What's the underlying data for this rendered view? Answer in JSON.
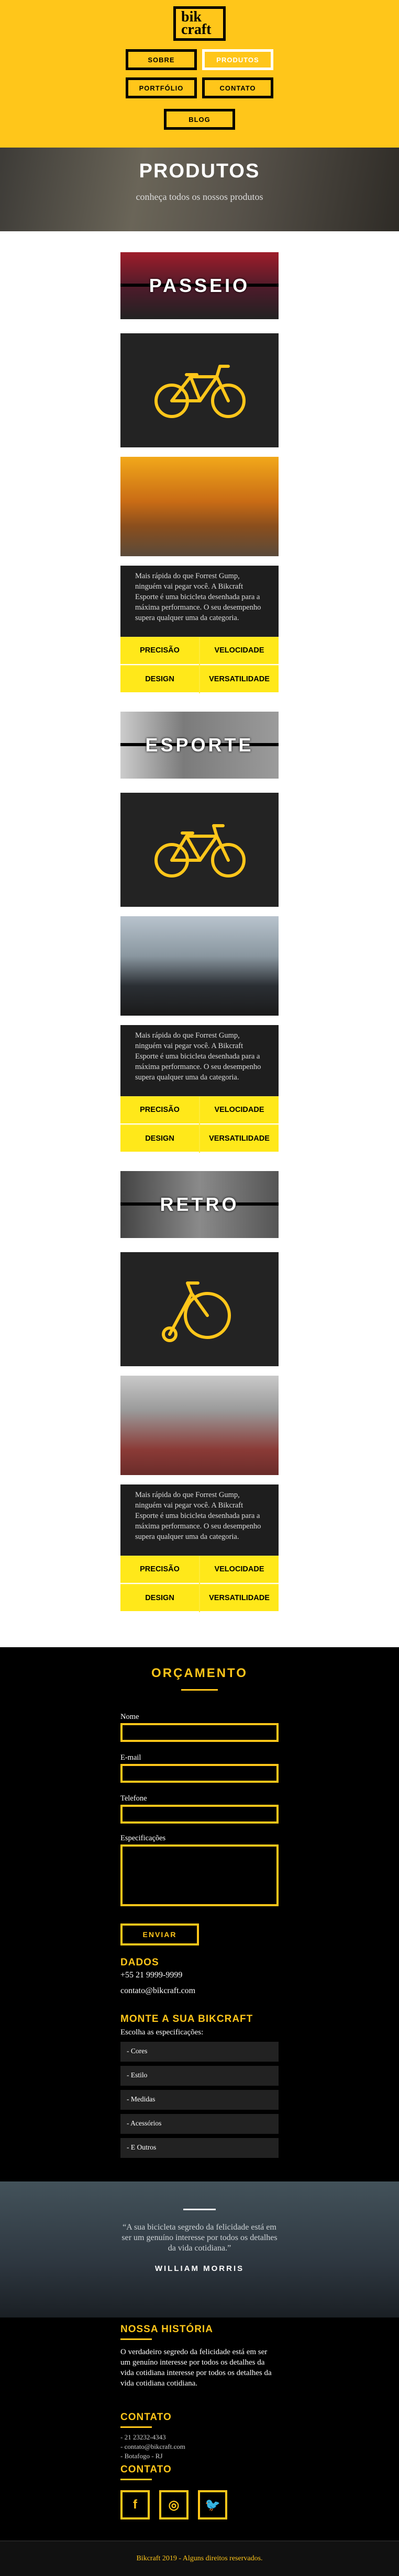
{
  "header": {
    "logo": "bikcraft",
    "nav": [
      {
        "label": "Sobre",
        "active": false
      },
      {
        "label": "Produtos",
        "active": true
      },
      {
        "label": "Portfólio",
        "active": false
      },
      {
        "label": "Contato",
        "active": false
      },
      {
        "label": "Blog",
        "active": false
      }
    ]
  },
  "banner": {
    "title": "PRODUTOS",
    "subtitle": "conheça todos os nossos produtos"
  },
  "products": [
    {
      "name": "PASSEIO",
      "icon": "passeio-bike-icon"
    },
    {
      "name": "ESPORTE",
      "icon": "esporte-bike-icon"
    },
    {
      "name": "RETRO",
      "icon": "retro-bike-icon"
    }
  ],
  "product_description": "Mais rápida do que Forrest Gump, ninguém vai pegar você. A Bikcraft Esporte é uma bicicleta desenhada para a máxima performance. O seu desempenho supera qualquer uma da categoria.",
  "features": [
    "PRECISÃO",
    "VELOCIDADE",
    "DESIGN",
    "VERSATILIDADE"
  ],
  "budget": {
    "title": "ORÇAMENTO",
    "fields": [
      "Nome",
      "E-mail",
      "Telefone",
      "Especificações"
    ],
    "send": "ENVIAR",
    "data_title": "DADOS",
    "phone": "+55 21 9999-9999",
    "email": "contato@bikcraft.com",
    "build_title": "MONTE A SUA BIKCRAFT",
    "build_label": "Escolha as especificações:",
    "options": [
      "- Cores",
      "- Estilo",
      "- Medidas",
      "- Acessórios",
      "- E Outros"
    ]
  },
  "quote": {
    "text": "“A sua bicicleta segredo da felicidade está em ser um genuíno interesse por todos os detalhes da vida cotidiana.”",
    "author": "WILLIAM MORRIS"
  },
  "footer": {
    "history_title": "NOSSA HISTÓRIA",
    "history_text": "O verdadeiro segredo da felicidade está em ser um genuíno interesse por todos os detalhes da vida cotidiana interesse por todos os detalhes da vida cotidiana cotidiana.",
    "contact_title": "CONTATO",
    "contact_lines": [
      "- 21 23232-4343",
      "- contato@bikcraft.com",
      "- Botafogo - RJ"
    ],
    "social_title": "CONTATO",
    "social": [
      {
        "icon": "facebook-icon",
        "glyph": "f"
      },
      {
        "icon": "instagram-icon",
        "glyph": "◎"
      },
      {
        "icon": "twitter-icon",
        "glyph": "🐦"
      }
    ],
    "copyright": "Bikcraft 2019 - Alguns direitos reservados."
  }
}
